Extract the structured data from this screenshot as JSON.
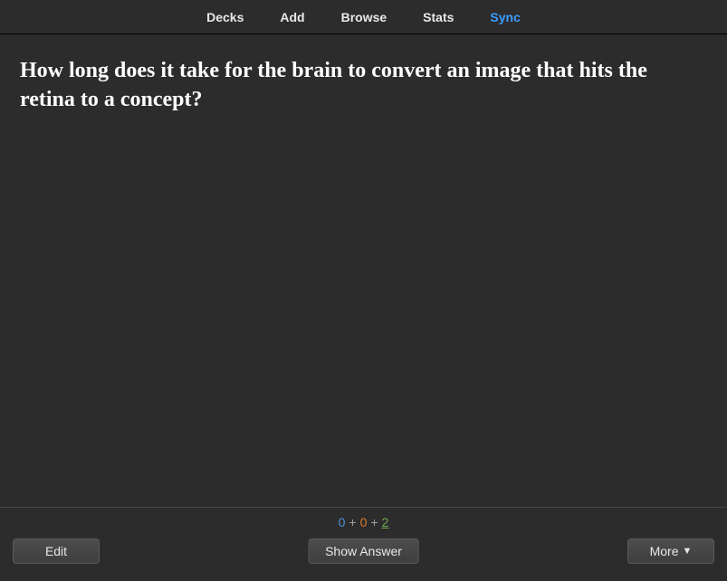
{
  "nav": {
    "decks": "Decks",
    "add": "Add",
    "browse": "Browse",
    "stats": "Stats",
    "sync": "Sync"
  },
  "card": {
    "question": "How long does it take for the brain to convert an image that hits the retina to a concept?"
  },
  "counts": {
    "new": "0",
    "learn": "0",
    "due": "2",
    "plus": "+"
  },
  "buttons": {
    "edit": "Edit",
    "show_answer": "Show Answer",
    "more": "More"
  }
}
